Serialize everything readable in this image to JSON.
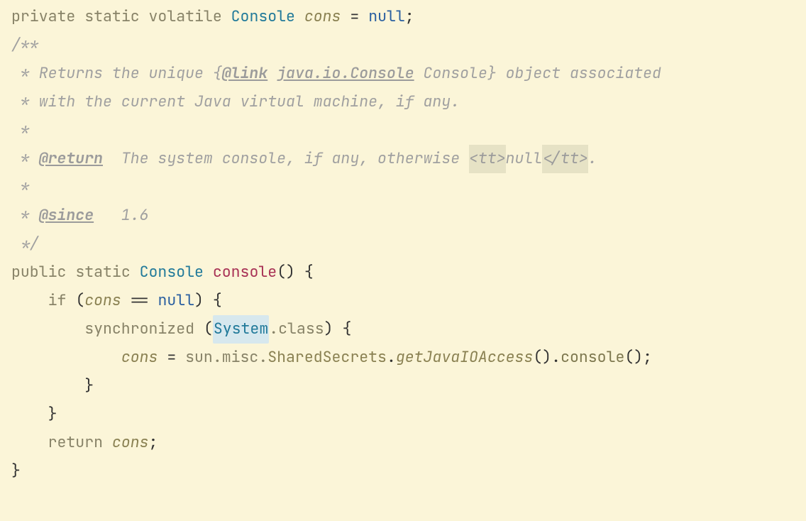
{
  "code": {
    "l1": {
      "kw_private": "private",
      "kw_static": "static",
      "kw_volatile": "volatile",
      "type": "Console",
      "field": "cons",
      "eq": "=",
      "null": "null",
      "semi": ";"
    },
    "l2": {
      "text": "/**"
    },
    "l3": {
      "star": " *",
      "txt1": " Returns the unique {",
      "atlink": "@link",
      "sp": " ",
      "linktarget": "java.io.Console",
      "linklabel": " Console",
      "txt2": "} object associated"
    },
    "l4": {
      "txt": " * with the current Java virtual machine, if any."
    },
    "l5": {
      "txt": " *"
    },
    "l6": {
      "star": " * ",
      "atreturn": "@return",
      "txt1": "  The system console, if any, otherwise ",
      "tagopen": "<tt>",
      "nulltxt": "null",
      "tagclose": "</tt>",
      "dot": "."
    },
    "l7": {
      "txt": " *"
    },
    "l8": {
      "star": " * ",
      "atsince": "@since",
      "val": "   1.6"
    },
    "l9": {
      "txt": " */"
    },
    "l10": {
      "kw_public": "public",
      "kw_static": "static",
      "type": "Console",
      "method": "console",
      "parens": "()",
      "brace": " {"
    },
    "l11": {
      "indent": "    ",
      "kw_if": "if",
      "open": " (",
      "field": "cons",
      "eq": " == ",
      "null": "null",
      "close": ") {"
    },
    "l12": {
      "indent": "        ",
      "kw_sync": "synchronized",
      "open": " (",
      "sys": "System",
      "dotclass": ".class",
      "close": ") {"
    },
    "l13": {
      "indent": "            ",
      "field": "cons",
      "eq": " = ",
      "pkg": "sun.misc.",
      "stype": "SharedSecrets",
      "dot1": ".",
      "smethod": "getJavaIOAccess",
      "p1": "().",
      "cmethod": "console",
      "p2": "();"
    },
    "l14": {
      "indent": "        ",
      "brace": "}"
    },
    "l15": {
      "indent": "    ",
      "brace": "}"
    },
    "l16": {
      "indent": "    ",
      "kw_return": "return",
      "sp": " ",
      "field": "cons",
      "semi": ";"
    },
    "l17": {
      "brace": "}"
    }
  }
}
